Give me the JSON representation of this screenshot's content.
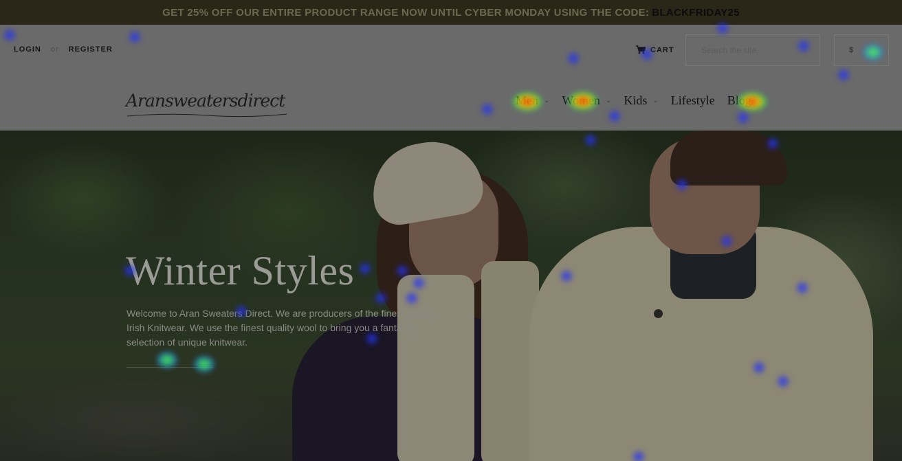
{
  "promo": {
    "text": "GET 25% OFF OUR ENTIRE PRODUCT RANGE NOW UNTIL CYBER MONDAY USING THE CODE:",
    "code": "BLACKFRIDAY25"
  },
  "header": {
    "login": "LOGIN",
    "separator": "or",
    "register": "REGISTER",
    "cart": "CART",
    "search_placeholder": "Search the site",
    "currency": "$",
    "logo": "Aransweatersdirect"
  },
  "nav": {
    "items": [
      {
        "label": "Men",
        "has_dropdown": true
      },
      {
        "label": "Women",
        "has_dropdown": true
      },
      {
        "label": "Kids",
        "has_dropdown": true
      },
      {
        "label": "Lifestyle",
        "has_dropdown": false
      },
      {
        "label": "Blog",
        "has_dropdown": true
      }
    ],
    "chevron": "⌄"
  },
  "hero": {
    "title": "Winter Styles",
    "text": "Welcome to Aran Sweaters Direct. We are producers of the finest quality Irish Knitwear. We use the finest quality wool to bring you a fantastic selection of unique knitwear."
  },
  "colors": {
    "promo_bg": "#2a2618",
    "header_bg": "#6a6a6a",
    "heat_blue": "#2838ff",
    "heat_green": "#50ff3c",
    "heat_red": "#ff1e00"
  }
}
